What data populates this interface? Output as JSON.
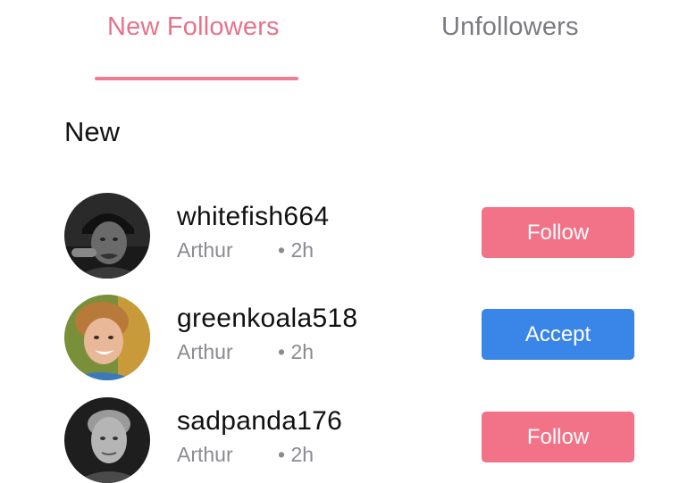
{
  "tabs": {
    "new_followers": "New Followers",
    "unfollowers": "Unfollowers"
  },
  "section_title": "New",
  "followers": [
    {
      "username": "whitefish664",
      "name": "Arthur",
      "time": "• 2h",
      "action": "Follow",
      "action_type": "follow"
    },
    {
      "username": "greenkoala518",
      "name": "Arthur",
      "time": "• 2h",
      "action": "Accept",
      "action_type": "accept"
    },
    {
      "username": "sadpanda176",
      "name": "Arthur",
      "time": "• 2h",
      "action": "Follow",
      "action_type": "follow"
    }
  ],
  "colors": {
    "active_tab": "#e8728a",
    "inactive_tab": "#7a7a80",
    "follow_button": "#f27287",
    "accept_button": "#3a86e8"
  }
}
